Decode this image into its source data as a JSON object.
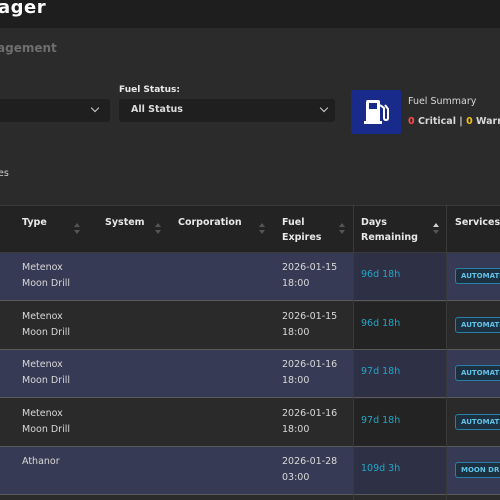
{
  "app": {
    "title": "ager",
    "subtitle": "agement"
  },
  "filters": {
    "fuel_status_label": "Fuel Status:",
    "fuel_status_value": "All Status"
  },
  "summary": {
    "title": "Fuel Summary",
    "critical_count": "0",
    "critical_label": "Critical",
    "separator": "|",
    "warning_count": "0",
    "warning_label": "Warnin"
  },
  "section_text": "es",
  "table": {
    "headers": {
      "type": "Type",
      "system": "System",
      "corporation": "Corporation",
      "fuel_expires_1": "Fuel",
      "fuel_expires_2": "Expires",
      "days_1": "Days",
      "days_2": "Remaining",
      "services": "Services"
    },
    "rows": [
      {
        "type_1": "Metenox",
        "type_2": "Moon Drill",
        "expires_date": "2026-01-15",
        "expires_time": "18:00",
        "days": "96d 18h",
        "service": "AUTOMATIO"
      },
      {
        "type_1": "Metenox",
        "type_2": "Moon Drill",
        "expires_date": "2026-01-15",
        "expires_time": "18:00",
        "days": "96d 18h",
        "service": "AUTOMATIO"
      },
      {
        "type_1": "Metenox",
        "type_2": "Moon Drill",
        "expires_date": "2026-01-16",
        "expires_time": "18:00",
        "days": "97d 18h",
        "service": "AUTOMATIO"
      },
      {
        "type_1": "Metenox",
        "type_2": "Moon Drill",
        "expires_date": "2026-01-16",
        "expires_time": "18:00",
        "days": "97d 18h",
        "service": "AUTOMATIO"
      },
      {
        "type_1": "Athanor",
        "type_2": "",
        "expires_date": "2026-01-28",
        "expires_time": "03:00",
        "days": "109d 3h",
        "service": "MOON DRIL"
      }
    ]
  },
  "colors": {
    "critical": "#ff4d4d",
    "warning": "#f2c300",
    "days": "#21a6c8",
    "icon_bg": "#182a8a"
  },
  "icons": {
    "summary": "fuel-pump-icon"
  }
}
